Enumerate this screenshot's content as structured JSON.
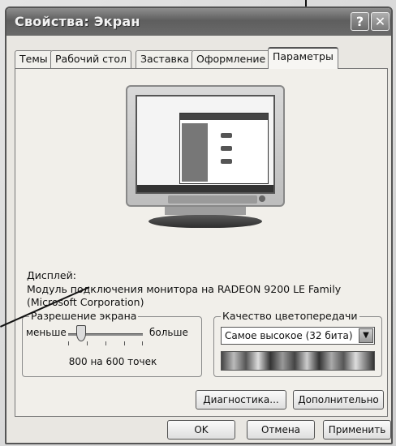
{
  "window": {
    "title": "Свойства: Экран"
  },
  "tabs": [
    {
      "label": "Темы"
    },
    {
      "label": "Рабочий стол"
    },
    {
      "label": "Заставка"
    },
    {
      "label": "Оформление"
    },
    {
      "label": "Параметры",
      "active": true
    }
  ],
  "display": {
    "label": "Дисплей:",
    "value": "Модуль подключения монитора на RADEON 9200 LE Family (Microsoft Corporation)"
  },
  "resolution": {
    "title": "Разрешение экрана",
    "less_label": "меньше",
    "more_label": "больше",
    "value": "800 на 600 точек"
  },
  "color_quality": {
    "title": "Качество цветопередачи",
    "selected": "Самое высокое (32 бита)"
  },
  "buttons": {
    "diagnostics": "Диагностика...",
    "advanced": "Дополнительно",
    "ok": "OK",
    "cancel": "Отмена",
    "apply": "Применить"
  },
  "icons": {
    "help": "help-icon",
    "close": "close-icon",
    "dropdown": "chevron-down-icon"
  }
}
